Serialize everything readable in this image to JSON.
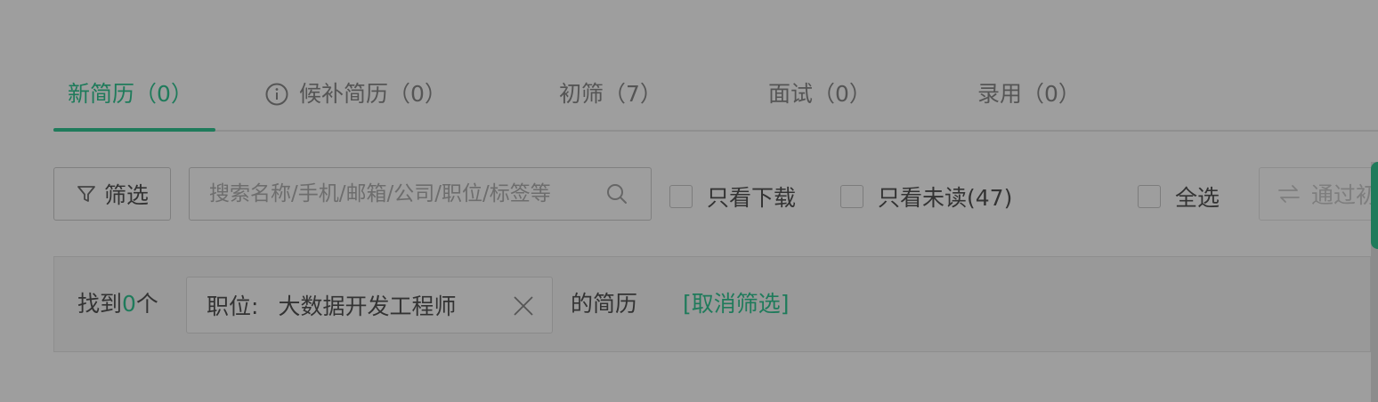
{
  "tabs": [
    {
      "label": "新简历（0）",
      "active": true
    },
    {
      "label": "候补简历（0）",
      "icon": "info-icon"
    },
    {
      "label": "初筛（7）"
    },
    {
      "label": "面试（0）"
    },
    {
      "label": "录用（0）"
    }
  ],
  "toolbar": {
    "filter_label": "筛选",
    "filter_icon": "funnel-icon",
    "search_placeholder": "搜索名称/手机/邮箱/公司/职位/标签等",
    "search_icon": "search-icon",
    "only_download_label": "只看下载",
    "only_unread_label": "只看未读(47)",
    "select_all_label": "全选",
    "pass_label": "通过初筛",
    "pass_icon": "swap-icon"
  },
  "result": {
    "prefix": "找到",
    "count": "0",
    "suffix": "个",
    "tag_label": "职位:",
    "tag_value": "大数据开发工程师",
    "tag_close_icon": "close-icon",
    "resume_text": "的简历",
    "cancel_label": "[取消筛选]"
  },
  "colors": {
    "accent": "#1f7b5b",
    "overlay_bg": "#9e9e9e"
  }
}
